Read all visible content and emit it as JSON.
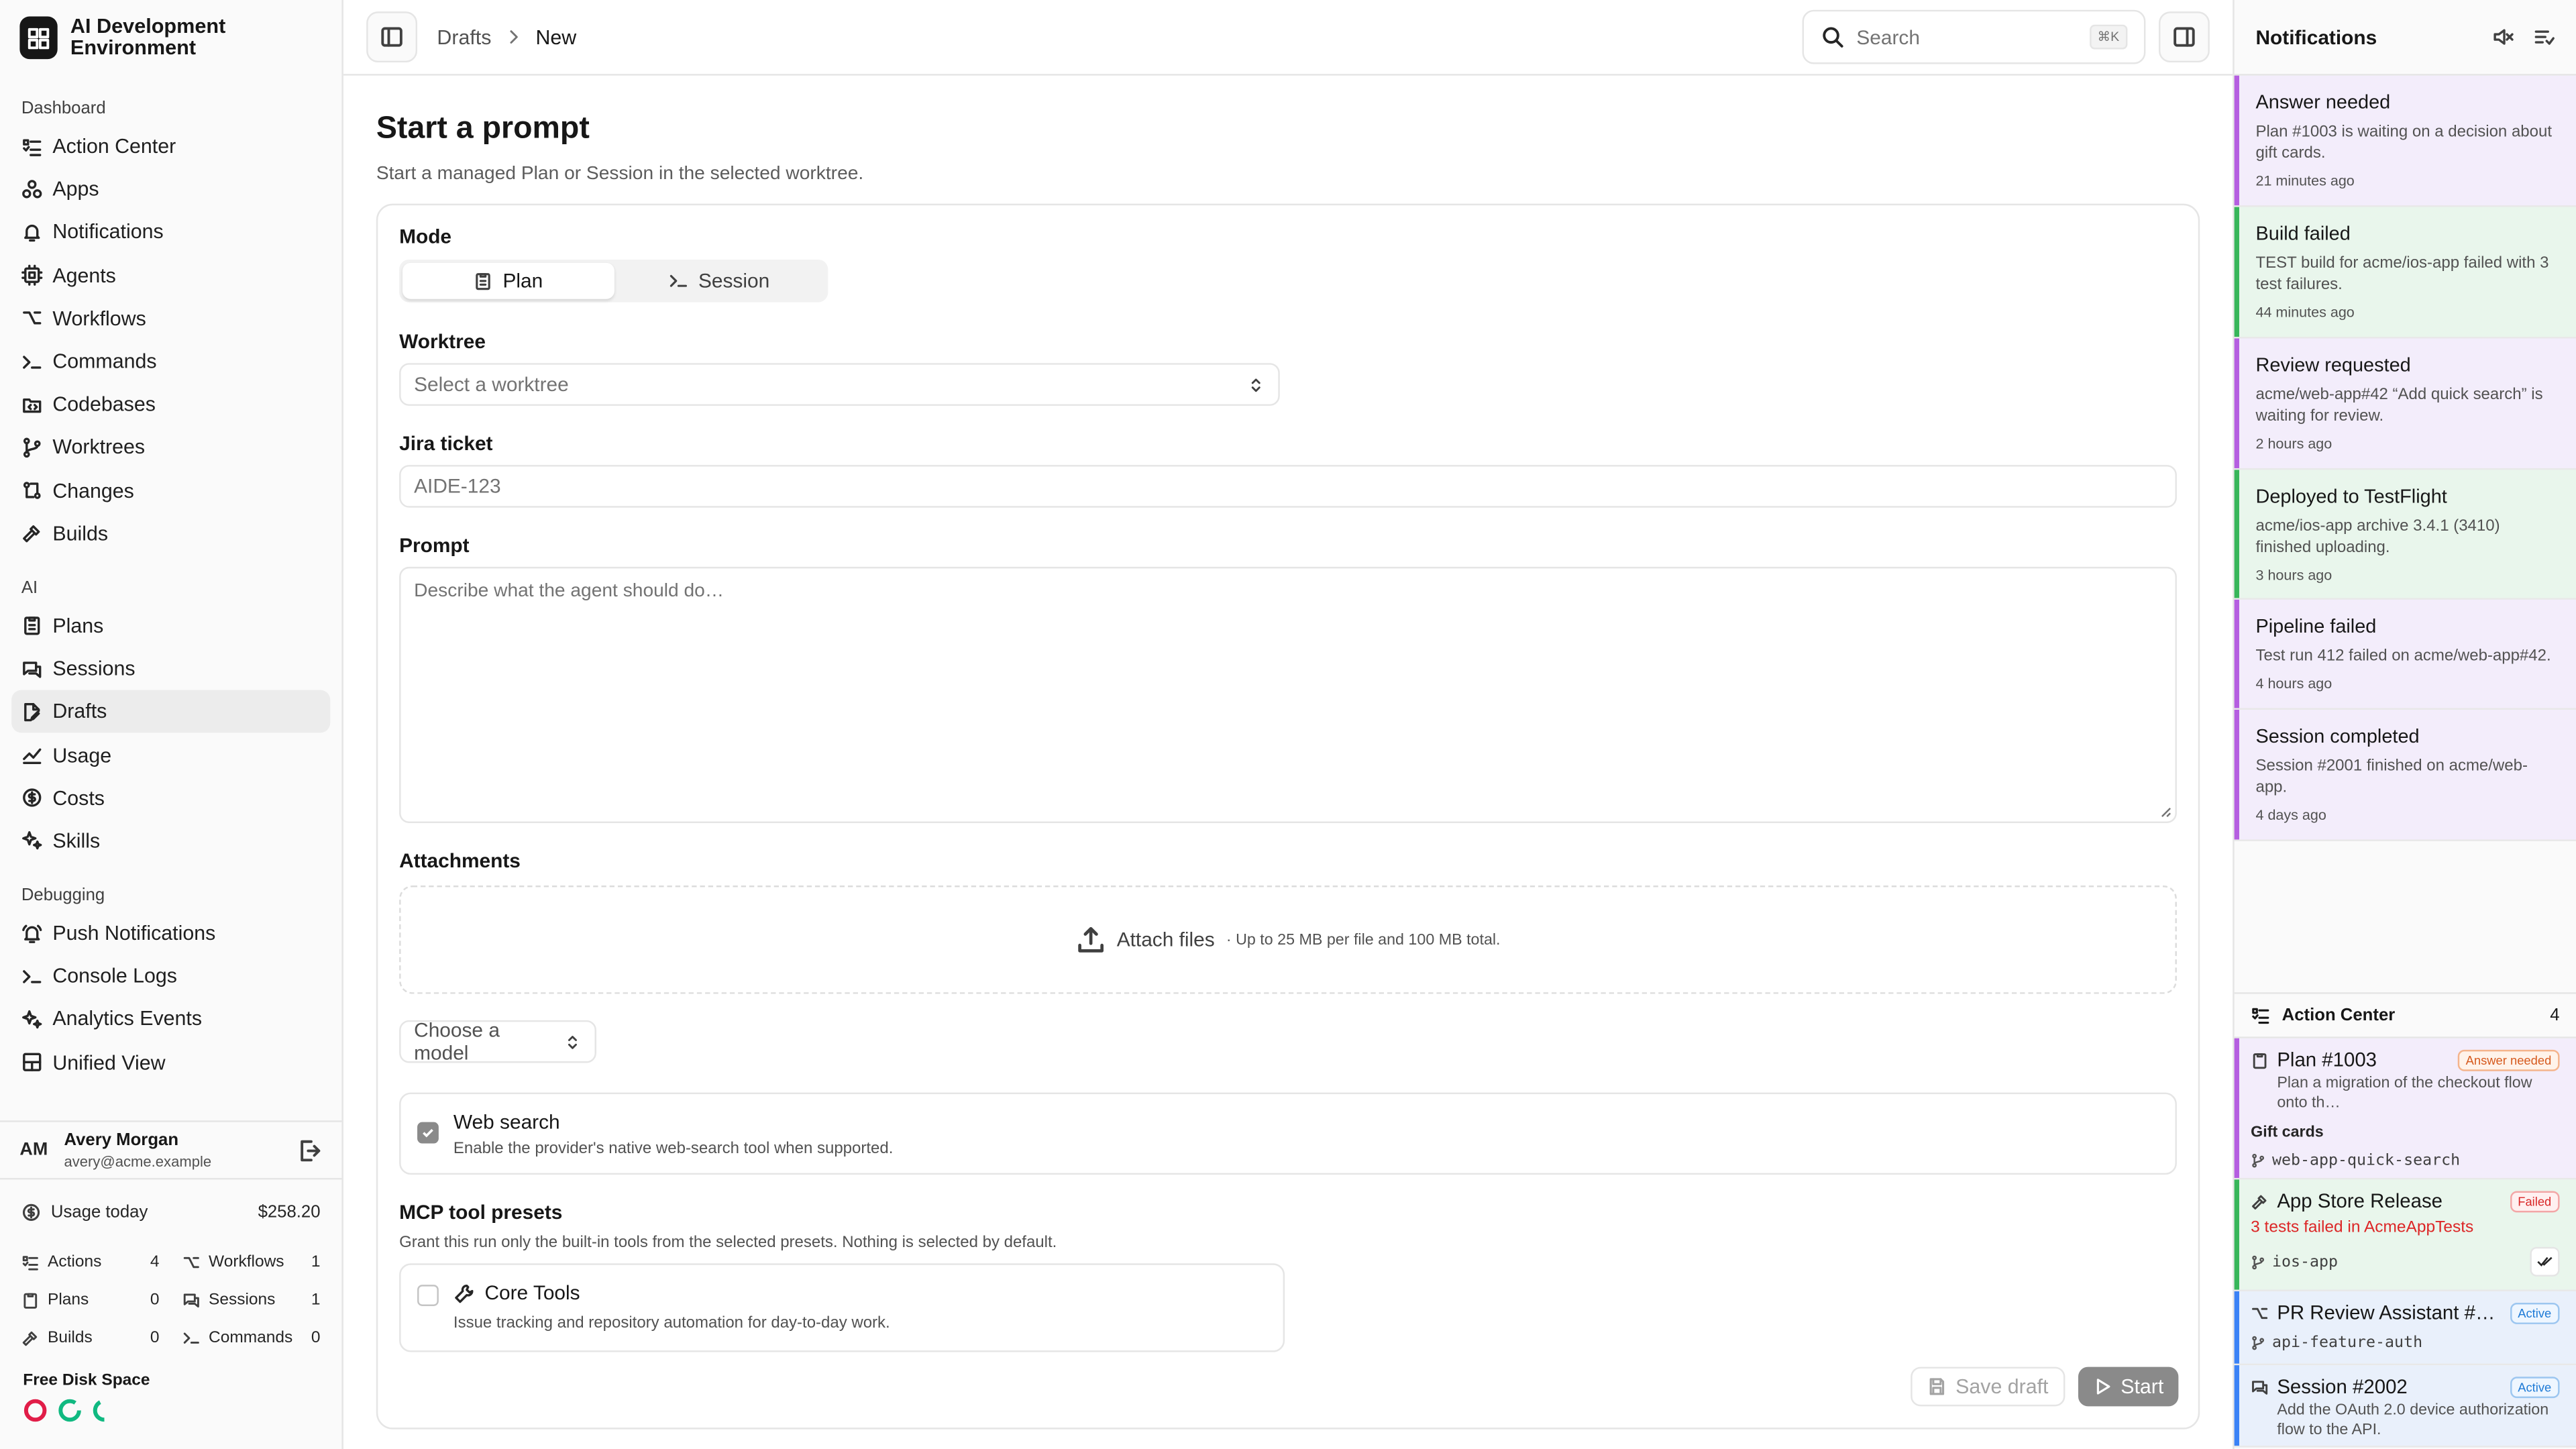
{
  "app": {
    "title": "AI Development Environment"
  },
  "sidebar": {
    "sections": [
      {
        "label": "Dashboard",
        "items": [
          "Action Center",
          "Apps",
          "Notifications",
          "Agents",
          "Workflows",
          "Commands",
          "Codebases",
          "Worktrees",
          "Changes",
          "Builds"
        ]
      },
      {
        "label": "AI",
        "items": [
          "Plans",
          "Sessions",
          "Drafts",
          "Usage",
          "Costs",
          "Skills"
        ]
      },
      {
        "label": "Debugging",
        "items": [
          "Push Notifications",
          "Console Logs",
          "Analytics Events",
          "Unified View"
        ]
      }
    ],
    "active_item": "Drafts",
    "user": {
      "initials": "AM",
      "name": "Avery Morgan",
      "email": "avery@acme.example"
    },
    "usage": {
      "label": "Usage today",
      "amount": "$258.20"
    },
    "stats": [
      {
        "label": "Actions",
        "value": "4",
        "icon": "list-check-icon"
      },
      {
        "label": "Workflows",
        "value": "1",
        "icon": "workflow-icon"
      },
      {
        "label": "Plans",
        "value": "0",
        "icon": "clipboard-icon"
      },
      {
        "label": "Sessions",
        "value": "1",
        "icon": "chat-icon"
      },
      {
        "label": "Builds",
        "value": "0",
        "icon": "hammer-icon"
      },
      {
        "label": "Commands",
        "value": "0",
        "icon": "terminal-icon"
      }
    ],
    "disk": {
      "label": "Free Disk Space",
      "colors": [
        "#e11d48",
        "#10b981",
        "#10b981"
      ]
    }
  },
  "topbar": {
    "breadcrumb": [
      "Drafts",
      "New"
    ],
    "search_placeholder": "Search",
    "search_shortcut": "⌘K"
  },
  "form": {
    "title": "Start a prompt",
    "subtitle": "Start a managed Plan or Session in the selected worktree.",
    "mode_label": "Mode",
    "modes": [
      "Plan",
      "Session"
    ],
    "selected_mode": "Plan",
    "worktree_label": "Worktree",
    "worktree_placeholder": "Select a worktree",
    "jira_label": "Jira ticket",
    "jira_placeholder": "AIDE-123",
    "prompt_label": "Prompt",
    "prompt_placeholder": "Describe what the agent should do…",
    "attachments_label": "Attachments",
    "attach_text": "Attach files",
    "attach_hint": "· Up to 25 MB per file and 100 MB total.",
    "model_placeholder": "Choose a model",
    "web_search": {
      "title": "Web search",
      "desc": "Enable the provider's native web-search tool when supported.",
      "checked": true
    },
    "mcp_label": "MCP tool presets",
    "mcp_desc": "Grant this run only the built-in tools from the selected presets. Nothing is selected by default.",
    "core_tools": {
      "title": "Core Tools",
      "desc": "Issue tracking and repository automation for day-to-day work.",
      "checked": false
    },
    "save_label": "Save draft",
    "start_label": "Start"
  },
  "notifications": {
    "title": "Notifications",
    "items": [
      {
        "title": "Answer needed",
        "body": "Plan #1003 is waiting on a decision about gift cards.",
        "time": "21 minutes ago",
        "color": "purple"
      },
      {
        "title": "Build failed",
        "body": "TEST build for acme/ios-app failed with 3 test failures.",
        "time": "44 minutes ago",
        "color": "green"
      },
      {
        "title": "Review requested",
        "body": "acme/web-app#42 “Add quick search” is waiting for review.",
        "time": "2 hours ago",
        "color": "purple"
      },
      {
        "title": "Deployed to TestFlight",
        "body": "acme/ios-app archive 3.4.1 (3410) finished uploading.",
        "time": "3 hours ago",
        "color": "green"
      },
      {
        "title": "Pipeline failed",
        "body": "Test run 412 failed on acme/web-app#42.",
        "time": "4 hours ago",
        "color": "purple"
      },
      {
        "title": "Session completed",
        "body": "Session #2001 finished on acme/web-app.",
        "time": "4 days ago",
        "color": "purple"
      }
    ]
  },
  "action_center": {
    "title": "Action Center",
    "count": "4",
    "items": [
      {
        "title": "Plan #1003",
        "badge": "Answer needed",
        "desc": "Plan a migration of the checkout flow onto th…",
        "sub": "Gift cards",
        "branch": "web-app-quick-search"
      },
      {
        "title": "App Store Release",
        "badge": "Failed",
        "error": "3 tests failed in AcmeAppTests",
        "branch": "ios-app"
      },
      {
        "title": "PR Review Assistant #4…",
        "badge": "Active",
        "branch": "api-feature-auth"
      },
      {
        "title": "Session #2002",
        "badge": "Active",
        "desc": "Add the OAuth 2.0 device authorization flow to the API."
      }
    ]
  }
}
